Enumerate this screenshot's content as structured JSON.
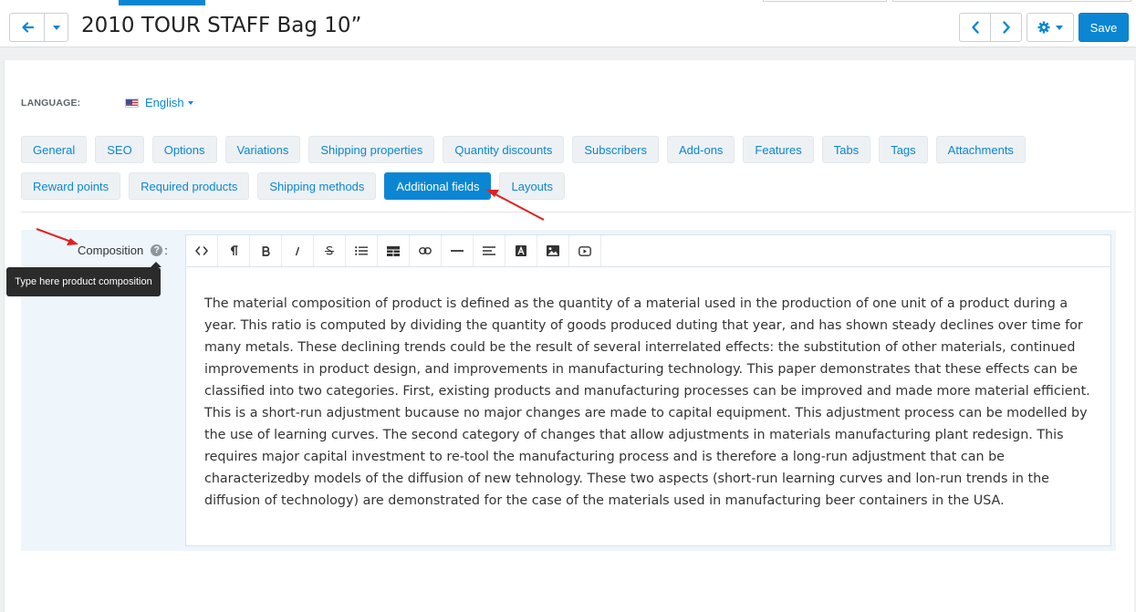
{
  "header": {
    "title": "2010 TOUR STAFF Bag 10”",
    "save_label": "Save"
  },
  "language": {
    "label": "LANGUAGE:",
    "value": "English"
  },
  "tabs": [
    {
      "label": "General"
    },
    {
      "label": "SEO"
    },
    {
      "label": "Options"
    },
    {
      "label": "Variations"
    },
    {
      "label": "Shipping properties"
    },
    {
      "label": "Quantity discounts"
    },
    {
      "label": "Subscribers"
    },
    {
      "label": "Add-ons"
    },
    {
      "label": "Features"
    },
    {
      "label": "Tabs"
    },
    {
      "label": "Tags"
    },
    {
      "label": "Attachments"
    },
    {
      "label": "Reward points"
    },
    {
      "label": "Required products"
    },
    {
      "label": "Shipping methods"
    },
    {
      "label": "Additional fields",
      "active": true
    },
    {
      "label": "Layouts"
    }
  ],
  "field": {
    "label": "Composition",
    "colon": ":",
    "help_icon": "question-circle-icon",
    "tooltip": "Type here product composition",
    "content": "The material composition of product is defined as the quantity of a material used in the production of one unit of a product during a year. This ratio is computed by dividing the quantity of goods produced duting that year, and has shown steady declines over time for many metals. These declining trends could be the result of several interrelated effects: the substitution of other materials, continued improvements in product design, and improvements in manufacturing technology. This paper demonstrates that these effects can be classified into two categories. First, existing products and manufacturing processes can be improved and made more material efficient. This is a short-run adjustment bucause no major changes are made to capital equipment. This adjustment process can be modelled by the use of learning curves. The second category of changes that allow adjustments in materials manufacturing plant redesign. This requires major capital investment to re-tool the manufacturing process and is therefore a long-run adjustment that can be characterizedby models of the diffusion of new tehnology. These two aspects (short-run learning curves and lon-run trends in the diffusion of technology) are demonstrated for the case of the materials used in manufacturing beer containers in the USA."
  },
  "editor_toolbar": [
    "code-view-icon",
    "paragraph-icon",
    "bold-icon",
    "italic-icon",
    "strikethrough-icon",
    "unordered-list-icon",
    "table-icon",
    "link-icon",
    "horizontal-rule-icon",
    "align-icon",
    "font-color-icon",
    "image-icon",
    "video-icon"
  ],
  "colors": {
    "accent": "#0b86d3",
    "annotation_arrow": "#e02020",
    "tooltip_bg": "#2b2b2b",
    "field_bg": "#eef6fc"
  }
}
